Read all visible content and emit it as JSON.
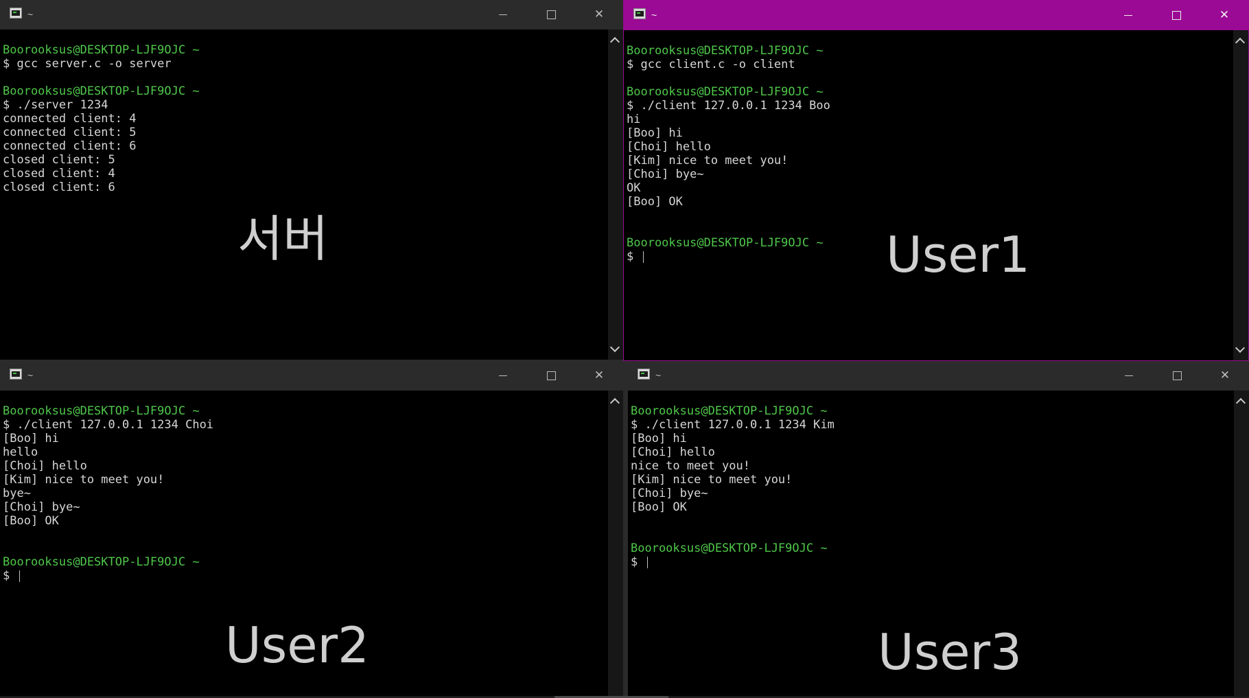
{
  "windows": {
    "server": {
      "title": "~",
      "label": "서버",
      "lines": [
        {
          "text": "Boorooksus@DESKTOP-LJF9OJC ~",
          "type": "prompt"
        },
        {
          "text": "$ gcc server.c -o server",
          "type": "cmd"
        },
        {
          "text": "",
          "type": "out"
        },
        {
          "text": "Boorooksus@DESKTOP-LJF9OJC ~",
          "type": "prompt"
        },
        {
          "text": "$ ./server 1234",
          "type": "cmd"
        },
        {
          "text": "connected client: 4",
          "type": "out"
        },
        {
          "text": "connected client: 5",
          "type": "out"
        },
        {
          "text": "connected client: 6",
          "type": "out"
        },
        {
          "text": "closed client: 5",
          "type": "out"
        },
        {
          "text": "closed client: 4",
          "type": "out"
        },
        {
          "text": "closed client: 6",
          "type": "out"
        }
      ]
    },
    "user1": {
      "title": "~",
      "label": "User1",
      "lines": [
        {
          "text": "Boorooksus@DESKTOP-LJF9OJC ~",
          "type": "prompt"
        },
        {
          "text": "$ gcc client.c -o client",
          "type": "cmd"
        },
        {
          "text": "",
          "type": "out"
        },
        {
          "text": "Boorooksus@DESKTOP-LJF9OJC ~",
          "type": "prompt"
        },
        {
          "text": "$ ./client 127.0.0.1 1234 Boo",
          "type": "cmd"
        },
        {
          "text": "hi",
          "type": "out"
        },
        {
          "text": "[Boo] hi",
          "type": "out"
        },
        {
          "text": "[Choi] hello",
          "type": "out"
        },
        {
          "text": "[Kim] nice to meet you!",
          "type": "out"
        },
        {
          "text": "[Choi] bye~",
          "type": "out"
        },
        {
          "text": "OK",
          "type": "out"
        },
        {
          "text": "[Boo] OK",
          "type": "out"
        },
        {
          "text": "",
          "type": "out"
        },
        {
          "text": "",
          "type": "out"
        },
        {
          "text": "Boorooksus@DESKTOP-LJF9OJC ~",
          "type": "prompt"
        },
        {
          "text": "$ ",
          "type": "input"
        }
      ]
    },
    "user2": {
      "title": "~",
      "label": "User2",
      "lines": [
        {
          "text": "Boorooksus@DESKTOP-LJF9OJC ~",
          "type": "prompt"
        },
        {
          "text": "$ ./client 127.0.0.1 1234 Choi",
          "type": "cmd"
        },
        {
          "text": "[Boo] hi",
          "type": "out"
        },
        {
          "text": "hello",
          "type": "out"
        },
        {
          "text": "[Choi] hello",
          "type": "out"
        },
        {
          "text": "[Kim] nice to meet you!",
          "type": "out"
        },
        {
          "text": "bye~",
          "type": "out"
        },
        {
          "text": "[Choi] bye~",
          "type": "out"
        },
        {
          "text": "[Boo] OK",
          "type": "out"
        },
        {
          "text": "",
          "type": "out"
        },
        {
          "text": "",
          "type": "out"
        },
        {
          "text": "Boorooksus@DESKTOP-LJF9OJC ~",
          "type": "prompt"
        },
        {
          "text": "$ ",
          "type": "input"
        }
      ]
    },
    "user3": {
      "title": "~",
      "label": "User3",
      "lines": [
        {
          "text": "Boorooksus@DESKTOP-LJF9OJC ~",
          "type": "prompt"
        },
        {
          "text": "$ ./client 127.0.0.1 1234 Kim",
          "type": "cmd"
        },
        {
          "text": "[Boo] hi",
          "type": "out"
        },
        {
          "text": "[Choi] hello",
          "type": "out"
        },
        {
          "text": "nice to meet you!",
          "type": "out"
        },
        {
          "text": "[Kim] nice to meet you!",
          "type": "out"
        },
        {
          "text": "[Choi] bye~",
          "type": "out"
        },
        {
          "text": "[Boo] OK",
          "type": "out"
        },
        {
          "text": "",
          "type": "out"
        },
        {
          "text": "",
          "type": "out"
        },
        {
          "text": "Boorooksus@DESKTOP-LJF9OJC ~",
          "type": "prompt"
        },
        {
          "text": "$ ",
          "type": "input"
        }
      ]
    }
  },
  "colors": {
    "prompt": "#4fc84a",
    "text": "#d7d7d7",
    "active_titlebar": "#9b0a94",
    "inactive_titlebar": "#2b2b2b",
    "background": "#000000"
  },
  "icons": {
    "app": "terminal-icon",
    "minimize": "minimize-icon",
    "maximize": "maximize-icon",
    "close": "close-icon"
  }
}
